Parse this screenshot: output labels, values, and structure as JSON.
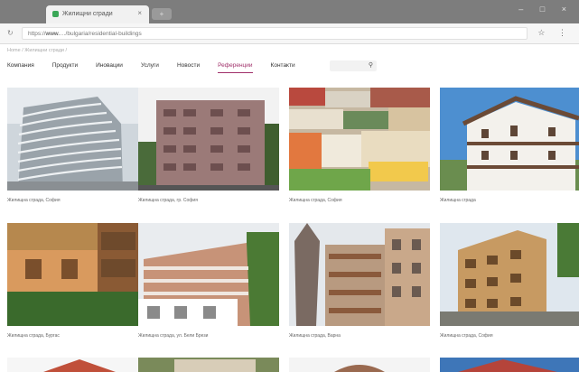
{
  "browser": {
    "tab_title": "Жилищни сгради",
    "tab_close": "×",
    "new_tab": "+",
    "window_controls": "– □ ×",
    "url_host": "www.",
    "url_rest": "…/bulgaria/residential-buildings",
    "addr_icons": "☆ ⋮"
  },
  "breadcrumb": "Home / Жилищни сгради /",
  "nav": {
    "items": [
      {
        "label": "Компания"
      },
      {
        "label": "Продукти"
      },
      {
        "label": "Иновации"
      },
      {
        "label": "Услуги"
      },
      {
        "label": "Новости"
      },
      {
        "label": "Референции",
        "active": true
      },
      {
        "label": "Контакти"
      }
    ],
    "search_icon": "⚲"
  },
  "gallery": [
    {
      "title": "Жилищна сграда, София",
      "subtitle": ""
    },
    {
      "title": "Жилищна сграда, гр. София",
      "subtitle": ""
    },
    {
      "title": "Жилищна сграда, София",
      "subtitle": ""
    },
    {
      "title": "Жилищна сграда",
      "subtitle": ""
    },
    {
      "title": "Жилищна сграда, Бургас",
      "subtitle": ""
    },
    {
      "title": "Жилищна сграда, ул. Бели Брези",
      "subtitle": ""
    },
    {
      "title": "Жилищна сграда, Варна",
      "subtitle": ""
    },
    {
      "title": "Жилищна сграда, София",
      "subtitle": ""
    }
  ],
  "colors": {
    "accent": "#a0306a",
    "chrome": "#7d7d7d"
  }
}
